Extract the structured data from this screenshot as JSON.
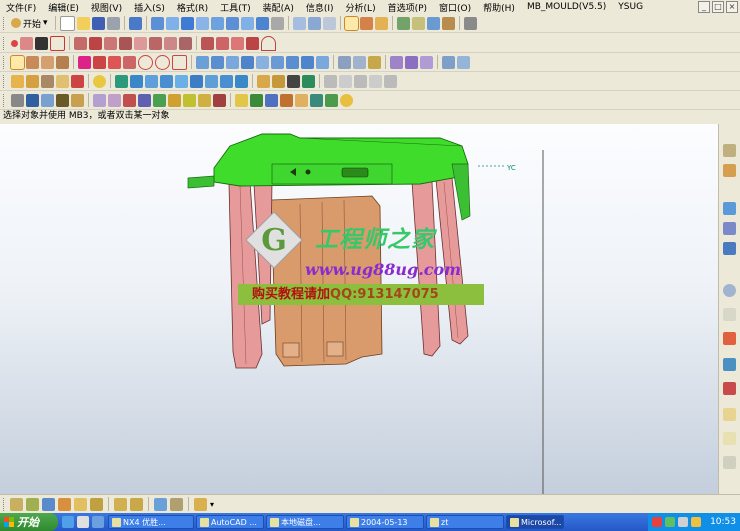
{
  "menu": {
    "items": [
      "文件(F)",
      "编辑(E)",
      "视图(V)",
      "插入(S)",
      "格式(R)",
      "工具(T)",
      "装配(A)",
      "信息(I)",
      "分析(L)",
      "首选项(P)",
      "窗口(O)",
      "帮助(H)",
      "MB_MOULD(V5.5)",
      "YSUG"
    ]
  },
  "toolbar": {
    "start_label": "开始"
  },
  "prompt": {
    "text": "选择对象并使用 MB3，或者双击某一对象"
  },
  "viewport": {
    "axis_label": "YC",
    "watermark_title": "工程师之家",
    "watermark_url": "www.ug88ug.com",
    "watermark_buy": "购买教程请加",
    "watermark_qq": "QQ:913147075"
  },
  "taskbar": {
    "start_label": "开始",
    "tasks": [
      "NX4 优胜...",
      "AutoCAD ...",
      "本地磁盘...",
      "2004-05-13",
      "zt",
      "Microsof..."
    ],
    "clock": "10:53"
  },
  "colors": {
    "model_green": "#3fdc2c",
    "model_pink": "#e69a9a",
    "model_tan": "#d99a6c",
    "taskbar_blue": "#2558c8"
  }
}
